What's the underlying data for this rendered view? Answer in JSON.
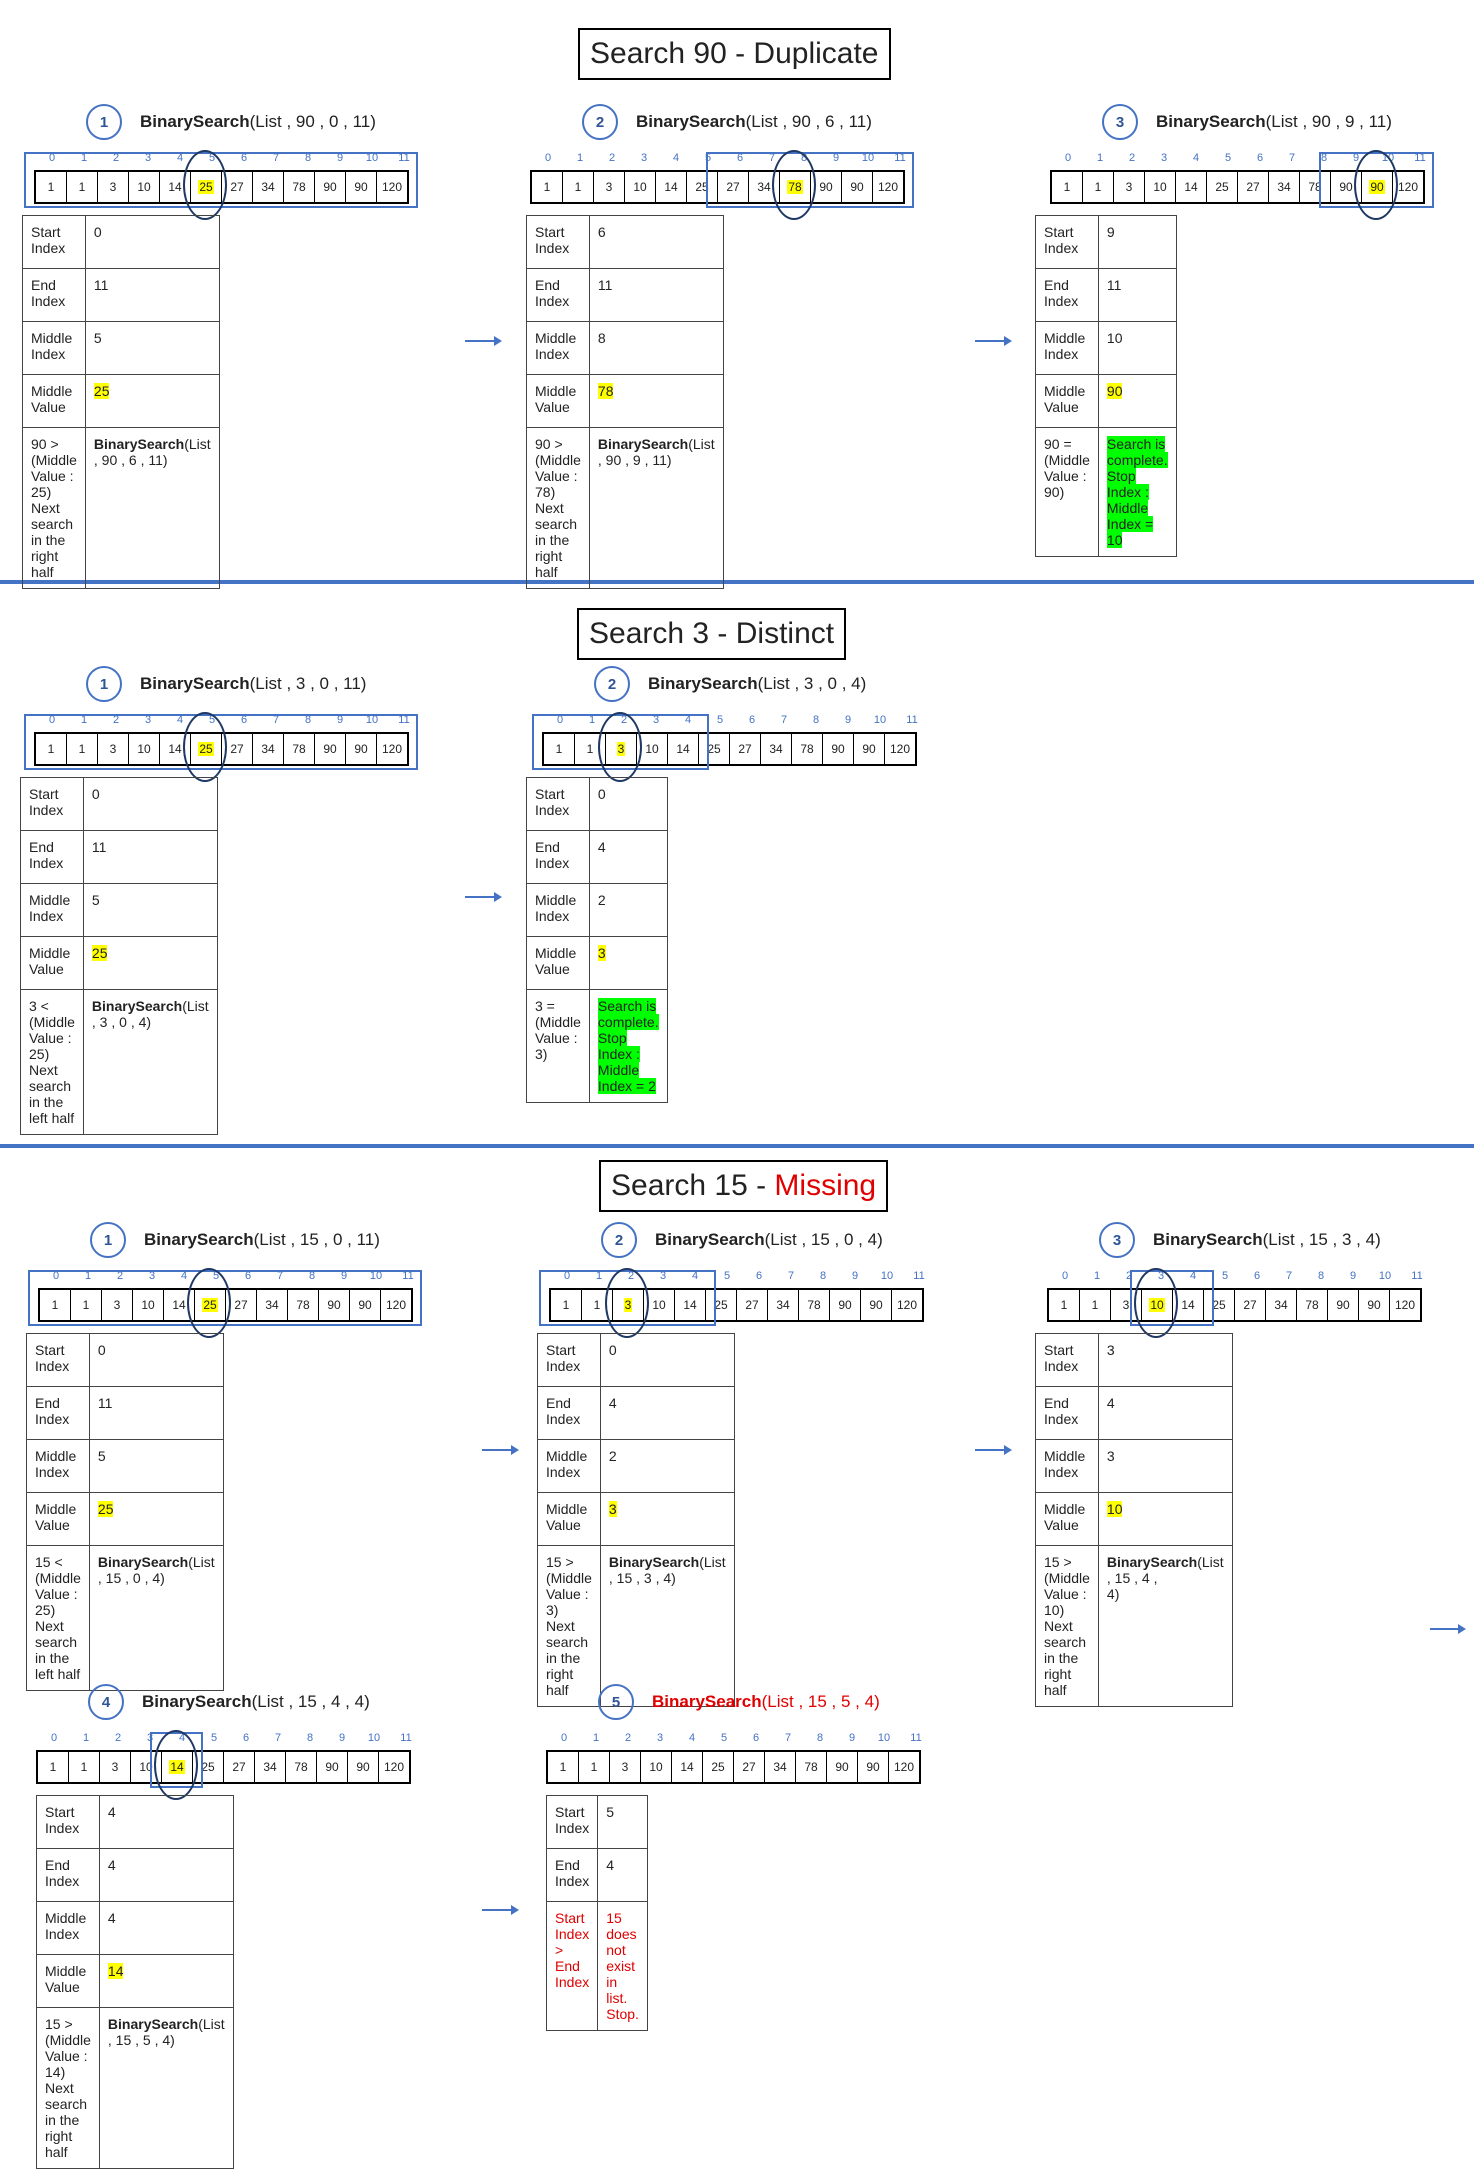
{
  "sections": {
    "s1": {
      "title": "Search 90  -  Duplicate"
    },
    "s2": {
      "title": "Search 3 - Distinct"
    },
    "s3": {
      "title_prefix": "Search 15  - ",
      "title_missing": "Missing"
    }
  },
  "list": {
    "indices": [
      "0",
      "1",
      "2",
      "3",
      "4",
      "5",
      "6",
      "7",
      "8",
      "9",
      "10",
      "11"
    ],
    "values": [
      "1",
      "1",
      "3",
      "10",
      "14",
      "25",
      "27",
      "34",
      "78",
      "90",
      "90",
      "120"
    ]
  },
  "labels": {
    "start_index": "Start Index",
    "end_index": "End Index",
    "middle_index": "Middle Index",
    "middle_value": "Middle Value",
    "func": "BinarySearch"
  },
  "steps": {
    "a1": {
      "num": "1",
      "args": "(List , 90 , 0 , 11)",
      "start": "0",
      "end": "11",
      "mid": "5",
      "midval": "25",
      "cmp1": "90 > (Middle Value : 25)",
      "cmp2": "Next search in the right half",
      "next_args": "(List , 90 , 6 , 11)",
      "highlight": 5
    },
    "a2": {
      "num": "2",
      "args": "(List , 90 , 6 , 11)",
      "start": "6",
      "end": "11",
      "mid": "8",
      "midval": "78",
      "cmp1": "90 > (Middle Value : 78)",
      "cmp2": "Next search in the right half",
      "next_args": "(List , 90 , 9 , 11)",
      "highlight": 8
    },
    "a3": {
      "num": "3",
      "args": "(List , 90 , 9 , 11)",
      "start": "9",
      "end": "11",
      "mid": "10",
      "midval": "90",
      "cmp1": "90 = (Middle Value : 90)",
      "done1": "Search is complete. Stop",
      "done2": "Index : Middle Index = 10",
      "highlight": 10
    },
    "b1": {
      "num": "1",
      "args": "(List , 3 , 0 , 11)",
      "start": "0",
      "end": "11",
      "mid": "5",
      "midval": "25",
      "cmp1": "3 < (Middle Value : 25)",
      "cmp2": "Next search in the left half",
      "next_args": "(List , 3 , 0 , 4)",
      "highlight": 5
    },
    "b2": {
      "num": "2",
      "args": "(List , 3 , 0 , 4)",
      "start": "0",
      "end": "4",
      "mid": "2",
      "midval": "3",
      "cmp1": "3 = (Middle Value : 3)",
      "done1": "Search is complete. Stop",
      "done2": "Index : Middle Index = 2",
      "highlight": 2
    },
    "c1": {
      "num": "1",
      "args": "(List , 15 , 0 , 11)",
      "start": "0",
      "end": "11",
      "mid": "5",
      "midval": "25",
      "cmp1": "15 < (Middle Value : 25)",
      "cmp2": "Next search in the left half",
      "next_args": "(List , 15 , 0 , 4)",
      "highlight": 5
    },
    "c2": {
      "num": "2",
      "args": "(List , 15 , 0 , 4)",
      "start": "0",
      "end": "4",
      "mid": "2",
      "midval": "3",
      "cmp1": "15 > (Middle Value : 3)",
      "cmp2": "Next search in the right half",
      "next_args": "(List , 15 , 3 , 4)",
      "highlight": 2
    },
    "c3": {
      "num": "3",
      "args": "(List , 15 , 3 , 4)",
      "start": "3",
      "end": "4",
      "mid": "3",
      "midval": "10",
      "cmp1": "15 > (Middle Value : 10)",
      "cmp2": "Next search in the right half",
      "next_args": "(List , 15 , 4 ,",
      "next_args2": "4)",
      "highlight": 3
    },
    "c4": {
      "num": "4",
      "args": "(List , 15 , 4 , 4)",
      "start": "4",
      "end": "4",
      "mid": "4",
      "midval": "14",
      "cmp1": "15 > (Middle Value : 14)",
      "cmp2": "Next search in the right half",
      "next_args": "(List , 15 , 5 , 4)",
      "highlight": 4
    },
    "c5": {
      "num": "5",
      "call": "BinarySearch(List , 15 , 5 , 4)",
      "start": "5",
      "end": "4",
      "cond": "Start Index > End Index",
      "result": "15 does not exist in list. Stop."
    }
  },
  "colors": {
    "accent": "#4472c4",
    "highlight": "#ffff00",
    "found": "#00ff00",
    "missing": "#e00000"
  }
}
